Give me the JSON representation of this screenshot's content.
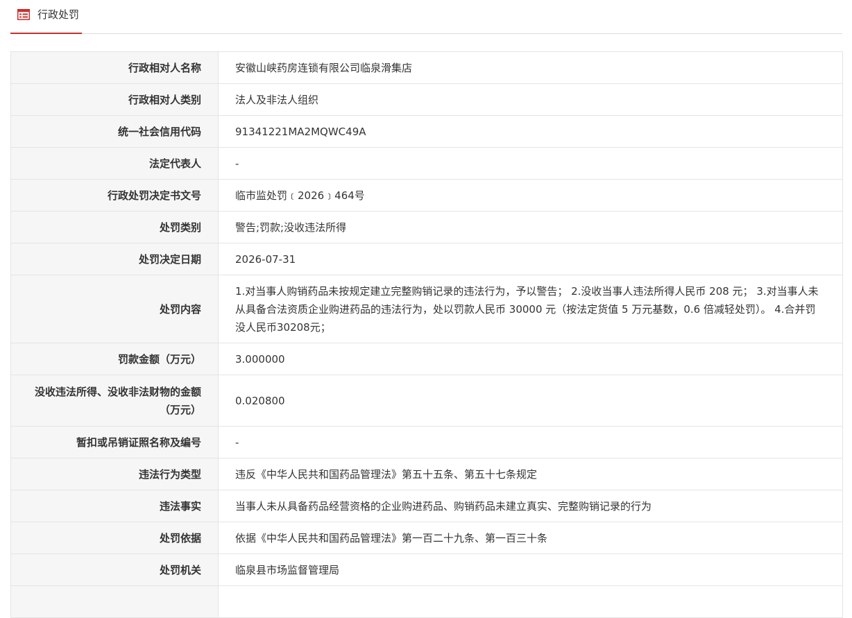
{
  "header": {
    "title": "行政处罚",
    "icon": "document-list-icon",
    "accent_color": "#c9302c"
  },
  "rows": [
    {
      "label": "行政相对人名称",
      "value": "安徽山峡药房连锁有限公司临泉滑集店"
    },
    {
      "label": "行政相对人类别",
      "value": "法人及非法人组织"
    },
    {
      "label": "统一社会信用代码",
      "value": "91341221MA2MQWC49A"
    },
    {
      "label": "法定代表人",
      "value": "-"
    },
    {
      "label": "行政处罚决定书文号",
      "value": "临市监处罚﹝2026﹞464号"
    },
    {
      "label": "处罚类别",
      "value": "警告;罚款;没收违法所得"
    },
    {
      "label": "处罚决定日期",
      "value": "2026-07-31"
    },
    {
      "label": "处罚内容",
      "value": "1.对当事人购销药品未按规定建立完整购销记录的违法行为，予以警告； 2.没收当事人违法所得人民币 208 元； 3.对当事人未从具备合法资质企业购进药品的违法行为，处以罚款人民币 30000 元（按法定货值 5 万元基数，0.6 倍减轻处罚）。 4.合并罚没人民币30208元；"
    },
    {
      "label": "罚款金额（万元）",
      "value": "3.000000"
    },
    {
      "label": "没收违法所得、没收非法财物的金额（万元）",
      "value": "0.020800"
    },
    {
      "label": "暂扣或吊销证照名称及编号",
      "value": "-"
    },
    {
      "label": "违法行为类型",
      "value": "违反《中华人民共和国药品管理法》第五十五条、第五十七条规定"
    },
    {
      "label": "违法事实",
      "value": "当事人未从具备药品经营资格的企业购进药品、购销药品未建立真实、完整购销记录的行为"
    },
    {
      "label": "处罚依据",
      "value": "依据《中华人民共和国药品管理法》第一百二十九条、第一百三十条"
    },
    {
      "label": "处罚机关",
      "value": "临泉县市场监督管理局"
    }
  ]
}
